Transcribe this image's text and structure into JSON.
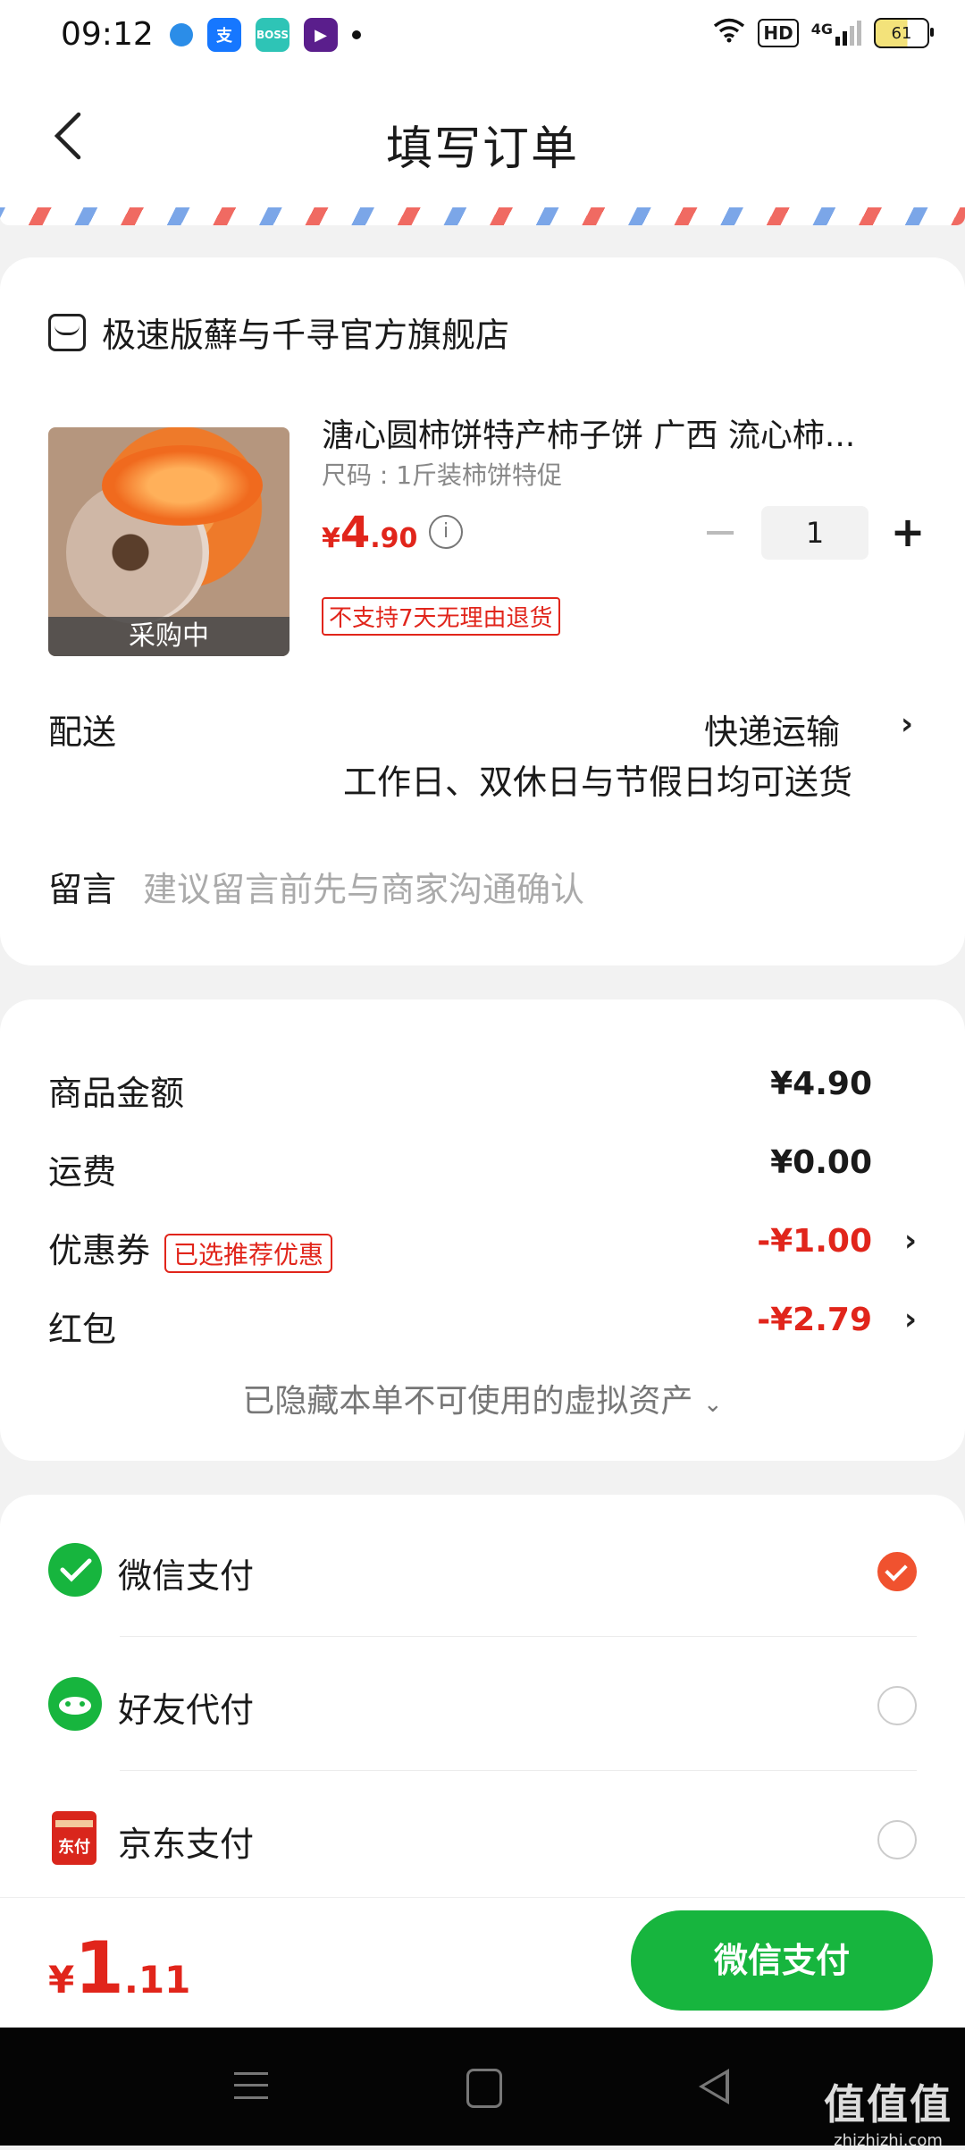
{
  "status_bar": {
    "time": "09:12",
    "hd": "HD",
    "network": "4G",
    "battery": "61"
  },
  "header": {
    "title": "填写订单"
  },
  "store": {
    "name": "极速版蘚与千寻官方旗舰店"
  },
  "product": {
    "name": "溏心圆柿饼特产柿子饼 广西 流心柿...",
    "sku": "尺码 : 1斤装柿饼特促",
    "price_symbol": "¥",
    "price_int": "4",
    "price_dec": ".90",
    "quantity": "1",
    "badge": "采购中",
    "no_return": "不支持7天无理由退货"
  },
  "delivery": {
    "label": "配送",
    "method": "快递运输",
    "note": "工作日、双休日与节假日均可送货"
  },
  "message": {
    "label": "留言",
    "placeholder": "建议留言前先与商家沟通确认"
  },
  "amounts": {
    "goods_label": "商品金额",
    "goods_value": "¥4.90",
    "shipping_label": "运费",
    "shipping_value": "¥0.00",
    "coupon_label": "优惠券",
    "coupon_tag": "已选推荐优惠",
    "coupon_value": "-¥1.00",
    "redpacket_label": "红包",
    "redpacket_value": "-¥2.79",
    "hidden_assets": "已隐藏本单不可使用的虚拟资产"
  },
  "payment": {
    "methods": [
      {
        "label": "微信支付",
        "selected": true
      },
      {
        "label": "好友代付",
        "selected": false
      },
      {
        "label": "京东支付",
        "selected": false
      }
    ]
  },
  "bottom": {
    "total_symbol": "¥",
    "total_int": "1",
    "total_dec": ".11",
    "pay_button": "微信支付"
  },
  "watermark": {
    "main": "值值值",
    "sub": "zhizhizhi.com"
  },
  "colors": {
    "accent_red": "#e1251b",
    "wechat_green": "#17b53e",
    "radio_selected": "#f0522f"
  }
}
